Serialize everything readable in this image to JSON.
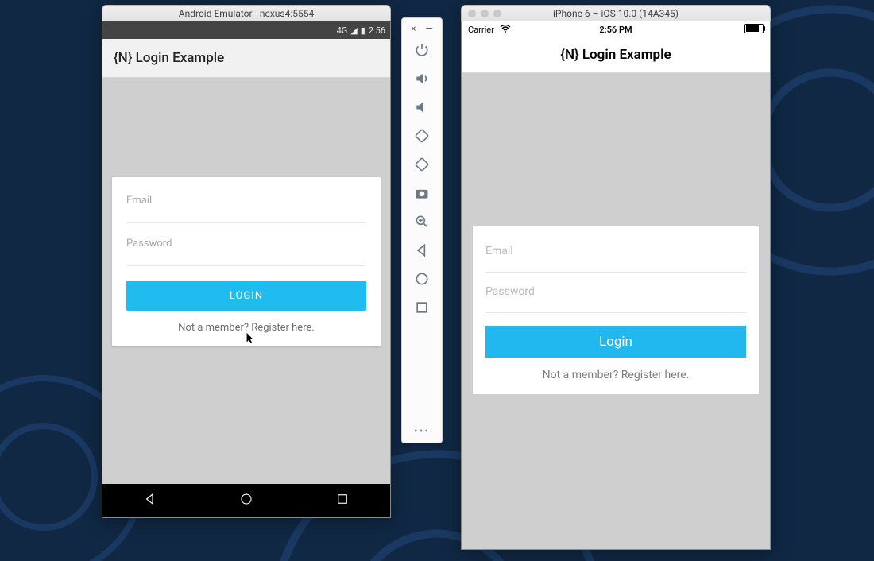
{
  "android": {
    "window_title": "Android Emulator - nexus4:5554",
    "status": {
      "network": "4G",
      "signal_icon": "signal-icon",
      "battery_icon": "battery-charging-icon",
      "time": "2:56"
    },
    "action_bar_title": "{N} Login Example",
    "fields": {
      "email_label": "Email",
      "password_label": "Password"
    },
    "login_button": "LOGIN",
    "register_link": "Not a member? Register here.",
    "nav": {
      "back": "back",
      "home": "home",
      "recents": "recents"
    }
  },
  "emu_toolbar": {
    "buttons": [
      "power",
      "volume-up",
      "volume-down",
      "rotate-left",
      "rotate-right",
      "camera",
      "zoom-in",
      "back",
      "circle",
      "square"
    ],
    "more": "…"
  },
  "ios": {
    "window_title": "iPhone 6 – iOS 10.0 (14A345)",
    "status": {
      "carrier": "Carrier",
      "time": "2:56 PM"
    },
    "nav_title": "{N} Login Example",
    "fields": {
      "email_label": "Email",
      "password_label": "Password"
    },
    "login_button": "Login",
    "register_link": "Not a member? Register here."
  },
  "colors": {
    "accent": "#20b8ee"
  }
}
